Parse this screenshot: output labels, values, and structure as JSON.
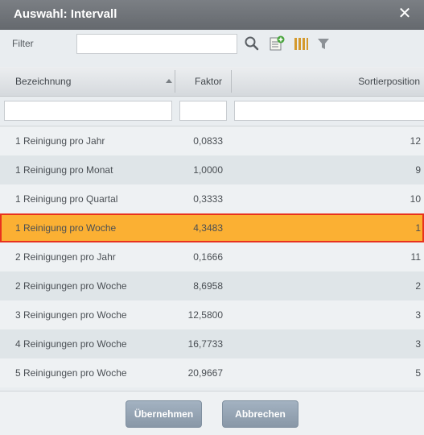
{
  "dialog": {
    "title": "Auswahl: Intervall"
  },
  "toolbar": {
    "filter_label": "Filter",
    "filter_value": ""
  },
  "columns": {
    "name": "Bezeichnung",
    "factor": "Faktor",
    "sort": "Sortierposition",
    "sort_direction": "ascending"
  },
  "rows": [
    {
      "name": "1 Reinigung pro Jahr",
      "factor": "0,0833",
      "sort": "12",
      "selected": false
    },
    {
      "name": "1 Reinigung pro Monat",
      "factor": "1,0000",
      "sort": "9",
      "selected": false
    },
    {
      "name": "1 Reinigung pro Quartal",
      "factor": "0,3333",
      "sort": "10",
      "selected": false
    },
    {
      "name": "1 Reinigung pro Woche",
      "factor": "4,3483",
      "sort": "1",
      "selected": true
    },
    {
      "name": "2 Reinigungen pro Jahr",
      "factor": "0,1666",
      "sort": "11",
      "selected": false
    },
    {
      "name": "2 Reinigungen pro Woche",
      "factor": "8,6958",
      "sort": "2",
      "selected": false
    },
    {
      "name": "3 Reinigungen pro Woche",
      "factor": "12,5800",
      "sort": "3",
      "selected": false
    },
    {
      "name": "4 Reinigungen pro Woche",
      "factor": "16,7733",
      "sort": "3",
      "selected": false
    },
    {
      "name": "5 Reinigungen pro Woche",
      "factor": "20,9667",
      "sort": "5",
      "selected": false
    }
  ],
  "buttons": {
    "apply": "Übernehmen",
    "cancel": "Abbrechen"
  },
  "colors": {
    "selected_row": "#fbb033",
    "selected_border": "#e8321e",
    "titlebar": "#6e7277"
  }
}
